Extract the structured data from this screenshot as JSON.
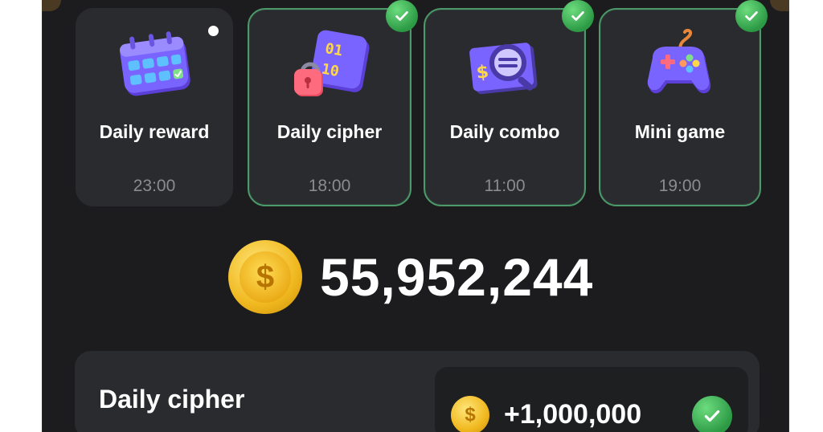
{
  "tasks": [
    {
      "label": "Daily reward",
      "time": "23:00",
      "completed": false,
      "icon": "calendar-icon"
    },
    {
      "label": "Daily cipher",
      "time": "18:00",
      "completed": true,
      "icon": "cipher-lock-icon"
    },
    {
      "label": "Daily combo",
      "time": "11:00",
      "completed": true,
      "icon": "combo-magnifier-icon"
    },
    {
      "label": "Mini game",
      "time": "19:00",
      "completed": true,
      "icon": "gamepad-icon"
    }
  ],
  "balance": {
    "value": "55,952,244",
    "coin_symbol": "$"
  },
  "cipher_banner": {
    "title": "Daily cipher",
    "reward": "+1,000,000",
    "coin_symbol": "$",
    "claimed": true
  },
  "colors": {
    "accent_green": "#2c9a45",
    "coin_gold": "#f0b81f",
    "card_bg": "#2a2b2e",
    "app_bg": "#1c1c1e"
  }
}
